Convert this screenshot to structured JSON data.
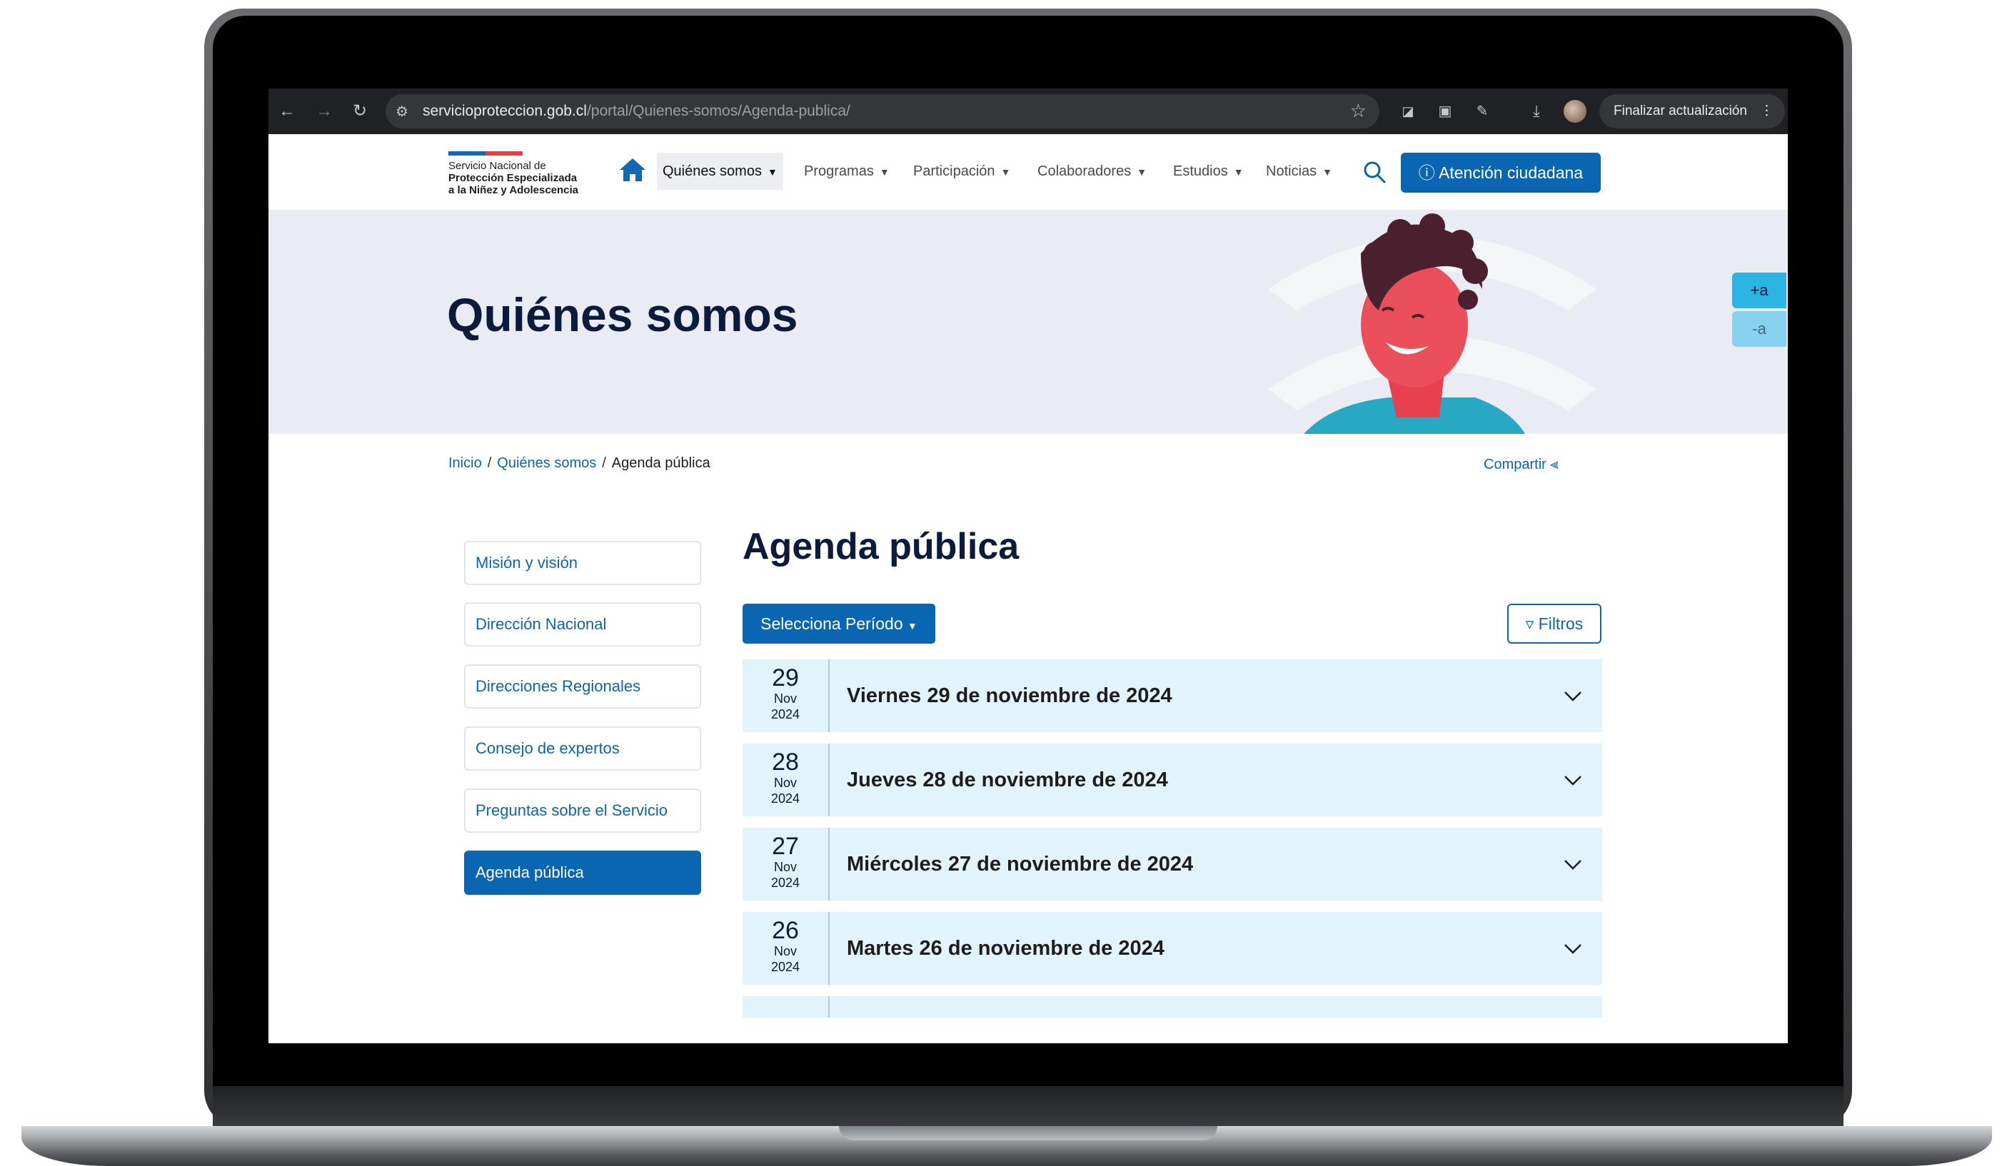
{
  "browser": {
    "url_host": "servicioproteccion.gob.cl",
    "url_path": "/portal/Quienes-somos/Agenda-publica/",
    "update_button": "Finalizar actualización"
  },
  "header": {
    "logo_line1": "Servicio Nacional de",
    "logo_line2": "Protección Especializada",
    "logo_line3": "a la Niñez y Adolescencia",
    "nav": [
      "Quiénes somos",
      "Programas",
      "Participación",
      "Colaboradores",
      "Estudios",
      "Noticias"
    ],
    "cta": "Atención ciudadana"
  },
  "hero": {
    "title": "Quiénes somos"
  },
  "font_controls": {
    "increase": "+a",
    "decrease": "-a"
  },
  "breadcrumb": {
    "home": "Inicio",
    "section": "Quiénes somos",
    "current": "Agenda pública"
  },
  "share": "Compartir",
  "sidebar": {
    "items": [
      {
        "label": "Misión y visión"
      },
      {
        "label": "Dirección Nacional"
      },
      {
        "label": "Direcciones Regionales"
      },
      {
        "label": "Consejo de expertos"
      },
      {
        "label": "Preguntas sobre el Servicio"
      },
      {
        "label": "Agenda pública"
      }
    ],
    "active_index": 5
  },
  "main": {
    "title": "Agenda pública",
    "period_button": "Selecciona Período",
    "filters_button": "Filtros",
    "entries": [
      {
        "day": "29",
        "month": "Nov",
        "year": "2024",
        "title": "Viernes 29 de noviembre de 2024"
      },
      {
        "day": "28",
        "month": "Nov",
        "year": "2024",
        "title": "Jueves 28 de noviembre de 2024"
      },
      {
        "day": "27",
        "month": "Nov",
        "year": "2024",
        "title": "Miércoles 27 de noviembre de 2024"
      },
      {
        "day": "26",
        "month": "Nov",
        "year": "2024",
        "title": "Martes 26 de noviembre de 2024"
      }
    ]
  },
  "colors": {
    "primary": "#0a66b0",
    "navy": "#0c1a3b",
    "row_bg": "#e1f4fb",
    "accessibility": "#2bb4e2"
  }
}
